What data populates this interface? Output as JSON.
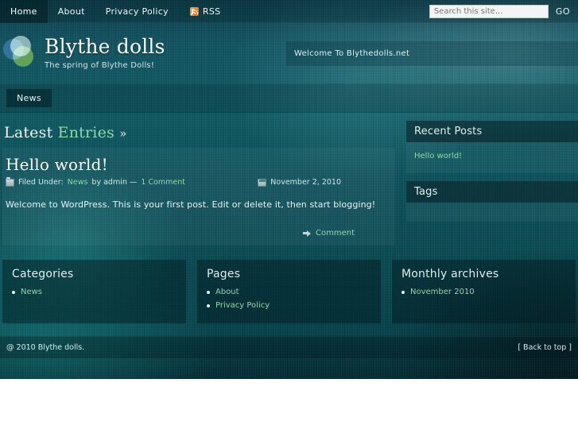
{
  "topbar": {
    "nav": [
      {
        "label": "Home",
        "active": true
      },
      {
        "label": "About",
        "active": false
      },
      {
        "label": "Privacy Policy",
        "active": false
      },
      {
        "label": "RSS",
        "active": false,
        "icon": "rss-icon"
      }
    ],
    "search": {
      "placeholder": "Search this site...",
      "value": "",
      "button_label": "GO"
    }
  },
  "header": {
    "title": "Blythe dolls",
    "tagline": "The spring of Blythe Dolls!",
    "welcome": "Welcome To Blythedolls.net",
    "logo_icon": "three-circles-logo"
  },
  "pagebar": {
    "items": [
      {
        "label": "News"
      }
    ]
  },
  "main": {
    "section_title": {
      "lead": "Latest",
      "highlight": "Entries",
      "arrows": "»"
    },
    "post": {
      "title": "Hello world!",
      "meta_prefix": "Filed Under:",
      "category": "News",
      "by_text": "by admin —",
      "comments_link": "1 Comment",
      "date": "November 2, 2010",
      "body": "Welcome to WordPress. This is your first post. Edit or delete it, then start blogging!",
      "comment_link": "Comment",
      "folder_icon": "folder-icon",
      "calendar_icon": "calendar-icon",
      "comment_icon": "arrow-right-icon"
    }
  },
  "sidebar": {
    "widgets": [
      {
        "title": "Recent Posts",
        "items": [
          "Hello world!"
        ]
      },
      {
        "title": "Tags",
        "items": []
      }
    ]
  },
  "footer_columns": [
    {
      "title": "Categories",
      "items": [
        "News"
      ]
    },
    {
      "title": "Pages",
      "items": [
        "About",
        "Privacy Policy"
      ]
    },
    {
      "title": "Monthly archives",
      "items": [
        "November 2010"
      ]
    }
  ],
  "bottombar": {
    "copyright": "@ 2010 Blythe dolls.",
    "back_to_top": "[ Back to top ]"
  },
  "colors": {
    "accent_green": "#8fd7a8",
    "text_light": "#e8f3f3",
    "rss_orange": "#f0740f",
    "teal_dark": "#04222d"
  }
}
